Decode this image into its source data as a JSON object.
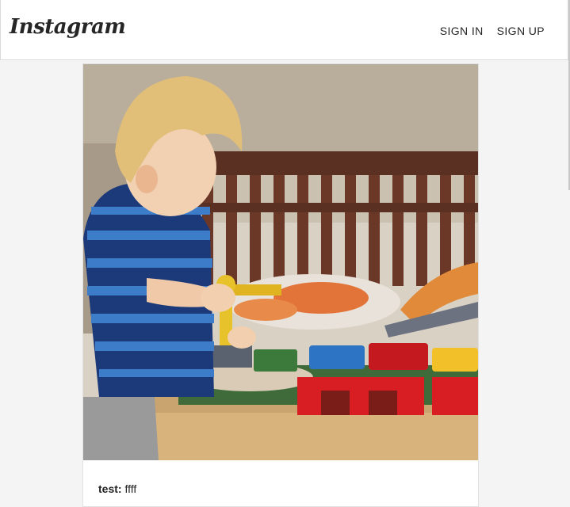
{
  "app": {
    "logo_text": "Instagram"
  },
  "nav": {
    "sign_in": "SIGN IN",
    "sign_up": "SIGN UP"
  },
  "post": {
    "username": "test:",
    "caption": "ffff"
  },
  "colors": {
    "header_bg": "#ffffff",
    "page_bg": "#f4f4f4",
    "text": "#262626"
  }
}
